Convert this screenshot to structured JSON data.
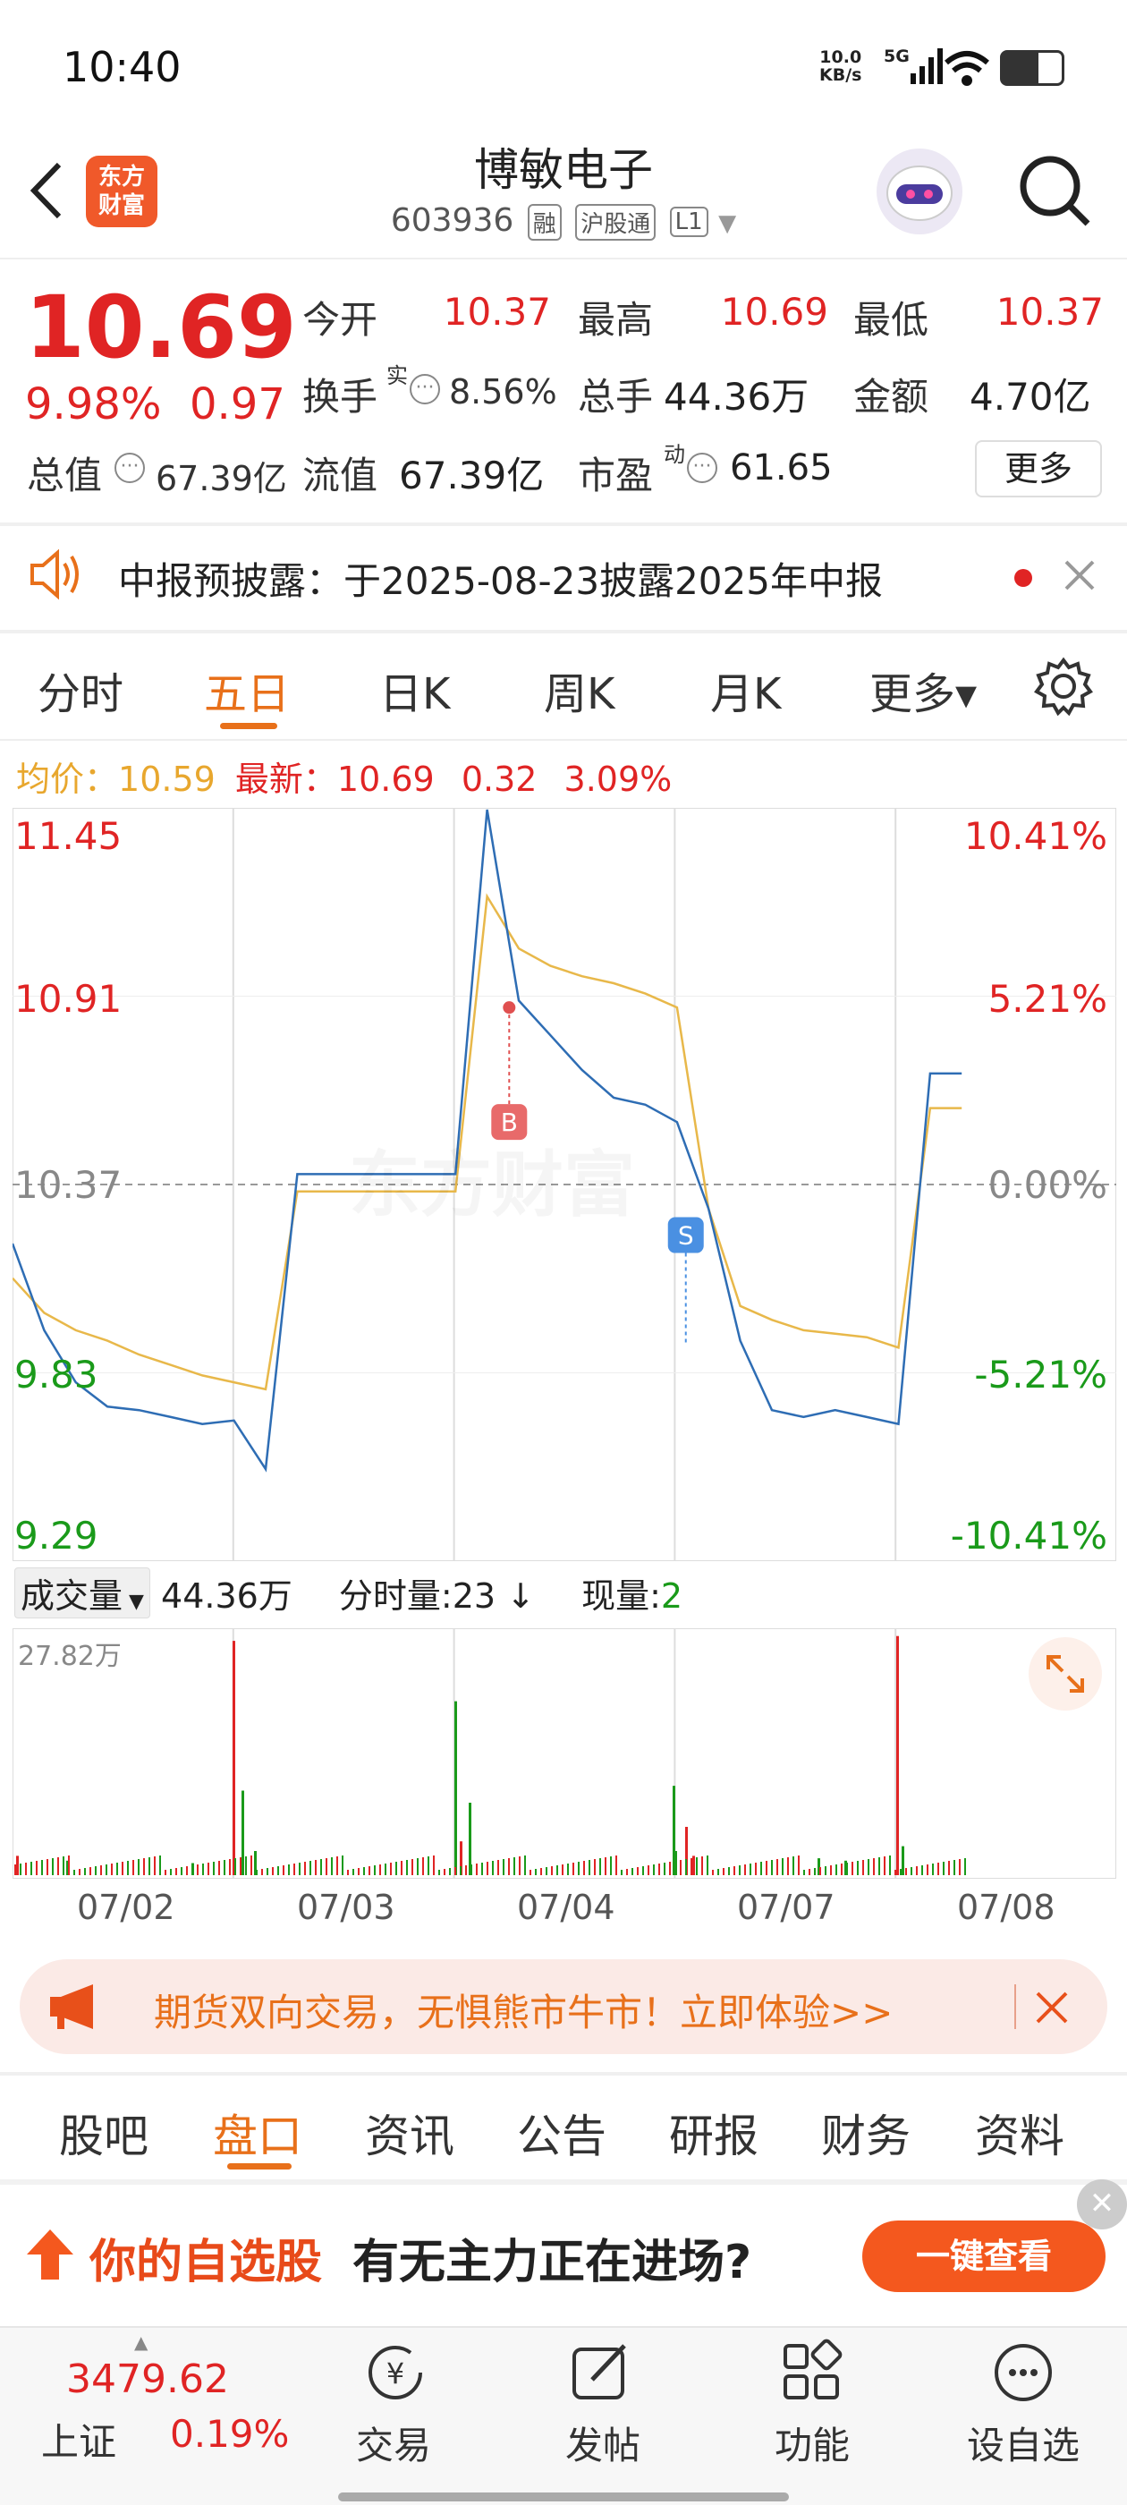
{
  "status": {
    "time": "10:40",
    "net_speed": "10.0",
    "net_unit": "KB/s",
    "signal": "5G"
  },
  "header": {
    "logo_line1": "东方",
    "logo_line2": "财富",
    "title": "博敏电子",
    "code": "603936",
    "tags": [
      "融",
      "沪股通",
      "L1"
    ]
  },
  "quote": {
    "price": "10.69",
    "change_pct": "9.98%",
    "change": "0.97",
    "open_label": "今开",
    "open": "10.37",
    "high_label": "最高",
    "high": "10.69",
    "low_label": "最低",
    "low": "10.37",
    "turnover_label": "换手",
    "turnover_sup": "实",
    "turnover": "8.56%",
    "volume_label": "总手",
    "volume": "44.36万",
    "amount_label": "金额",
    "amount": "4.70亿",
    "mcap_label": "总值",
    "mcap": "67.39亿",
    "float_label": "流值",
    "float": "67.39亿",
    "pe_label": "市盈",
    "pe_sup": "动",
    "pe": "61.65",
    "more": "更多"
  },
  "notice": {
    "text": "中报预披露：于2025-08-23披露2025年中报"
  },
  "chart_tabs": [
    {
      "label": "分时",
      "active": false
    },
    {
      "label": "五日",
      "active": true
    },
    {
      "label": "日K",
      "active": false
    },
    {
      "label": "周K",
      "active": false
    },
    {
      "label": "月K",
      "active": false
    },
    {
      "label": "更多▾",
      "active": false
    }
  ],
  "chart_info": {
    "avg_label": "均价：",
    "avg": "10.59",
    "latest_label": "最新：",
    "latest": "10.69",
    "latest_change": "0.32",
    "latest_pct": "3.09%"
  },
  "chart_data": {
    "type": "line",
    "title": "",
    "x": [
      "07/02",
      "07/03",
      "07/04",
      "07/07",
      "07/08"
    ],
    "y_left_ticks": [
      "11.45",
      "10.91",
      "10.37",
      "9.83",
      "9.29"
    ],
    "y_right_ticks": [
      "10.41%",
      "5.21%",
      "0.00%",
      "-5.21%",
      "-10.41%"
    ],
    "ylim": [
      9.29,
      11.45
    ],
    "baseline": 10.37,
    "series": [
      {
        "values": [
          10.2,
          9.95,
          9.8,
          9.73,
          9.72,
          9.7,
          9.68,
          9.69,
          9.55,
          10.4,
          10.4,
          10.4,
          10.4,
          10.4,
          10.4,
          11.45,
          10.9,
          10.8,
          10.7,
          10.62,
          10.6,
          10.55,
          10.3,
          9.92,
          9.72,
          9.7,
          9.72,
          9.7,
          9.68,
          10.69,
          10.69
        ]
      },
      {
        "values": [
          10.1,
          10.0,
          9.95,
          9.92,
          9.88,
          9.85,
          9.82,
          9.8,
          9.78,
          10.35,
          10.35,
          10.35,
          10.35,
          10.35,
          10.35,
          11.2,
          11.05,
          11.0,
          10.97,
          10.95,
          10.92,
          10.88,
          10.3,
          10.02,
          9.98,
          9.95,
          9.94,
          9.93,
          9.9,
          10.59,
          10.59
        ]
      }
    ],
    "markers": [
      {
        "label": "B",
        "price": 10.88
      },
      {
        "label": "S",
        "price": 10.25
      }
    ],
    "watermark": "东方财富"
  },
  "volume": {
    "label": "成交量",
    "total": "44.36万",
    "tick_label": "分时量:",
    "tick": "23",
    "now_label": "现量:",
    "now": "2",
    "max": "27.82万",
    "spikes": [
      0.08,
      0.06,
      0.05,
      0.97,
      0.35,
      0.1,
      0.14,
      0.72,
      0.3,
      0.08,
      0.1,
      0.37,
      0.2,
      0.07,
      0.06,
      0.99,
      0.12
    ]
  },
  "ad": {
    "text": "期货双向交易，无惧熊市牛市！立即体验>>"
  },
  "bottom_tabs": [
    {
      "label": "股吧",
      "active": false
    },
    {
      "label": "盘口",
      "active": true
    },
    {
      "label": "资讯",
      "active": false
    },
    {
      "label": "公告",
      "active": false
    },
    {
      "label": "研报",
      "active": false
    },
    {
      "label": "财务",
      "active": false
    },
    {
      "label": "资料",
      "active": false
    }
  ],
  "promo": {
    "highlight": "你的自选股",
    "text": "有无主力正在进场?",
    "button": "一键查看",
    "close": "✕"
  },
  "nav": {
    "index_value": "3479.62",
    "index_name": "上证",
    "index_pct": "0.19%",
    "items": [
      "交易",
      "发帖",
      "功能",
      "设自选"
    ]
  },
  "colors": {
    "up": "#e02424",
    "down": "#1a9a1a",
    "accent": "#e8701a",
    "price_line": "#2e6db4",
    "avg_line": "#e8b84a"
  }
}
